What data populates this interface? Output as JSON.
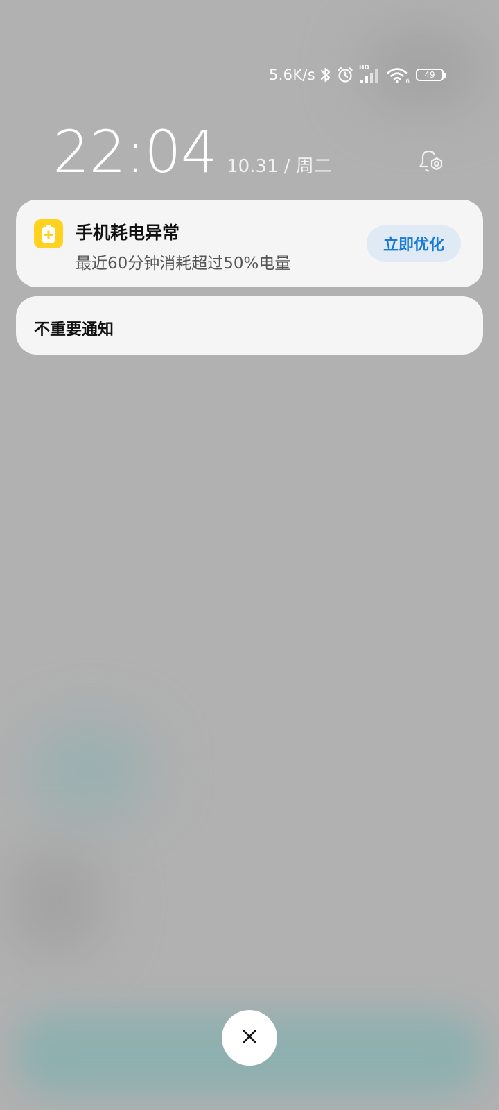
{
  "status_bar": {
    "net_speed": "5.6K/s",
    "network_label": "HD",
    "wifi_label": "6",
    "battery_level": "49",
    "icons": [
      "bluetooth-icon",
      "alarm-icon",
      "signal-hd-icon",
      "wifi-icon",
      "battery-icon"
    ]
  },
  "lockscreen": {
    "time": "22:04",
    "date": "10.31 / 周二"
  },
  "notifications": {
    "battery_alert": {
      "app_icon": "battery-plus-icon",
      "title": "手机耗电异常",
      "body": "最近60分钟消耗超过50%电量",
      "action_label": "立即优化"
    },
    "unimportant": {
      "label": "不重要通知"
    }
  },
  "controls": {
    "close_icon": "close-icon"
  },
  "colors": {
    "background": "#b1b1b1",
    "card": "#f5f5f5",
    "app_icon": "#ffd21f",
    "action_bg": "#e0eaf5",
    "action_text": "#1a7ad6"
  }
}
